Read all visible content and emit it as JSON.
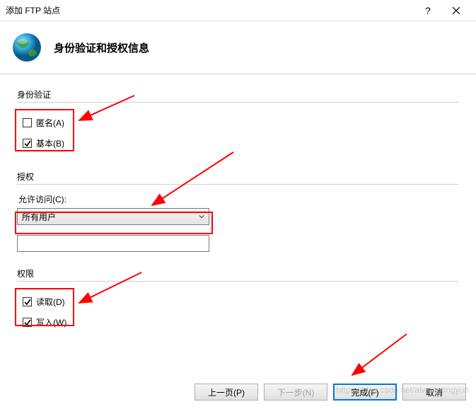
{
  "titlebar": {
    "title": "添加 FTP 站点"
  },
  "header": {
    "title": "身份验证和授权信息"
  },
  "auth": {
    "section_title": "身份验证",
    "anonymous": {
      "label": "匿名(A)",
      "checked": false
    },
    "basic": {
      "label": "基本(B)",
      "checked": true
    }
  },
  "authz": {
    "section_title": "授权",
    "allow_access_label": "允许访问(C):",
    "dropdown_value": "所有用户"
  },
  "permissions": {
    "section_title": "权限",
    "read": {
      "label": "读取(D)",
      "checked": true
    },
    "write": {
      "label": "写入(W)",
      "checked": true
    }
  },
  "footer": {
    "prev": "上一页(P)",
    "next": "下一步(N)",
    "finish": "完成(F)",
    "cancel": "取消"
  },
  "watermark": "https://blog.csdn.net/aiwangtingyun"
}
